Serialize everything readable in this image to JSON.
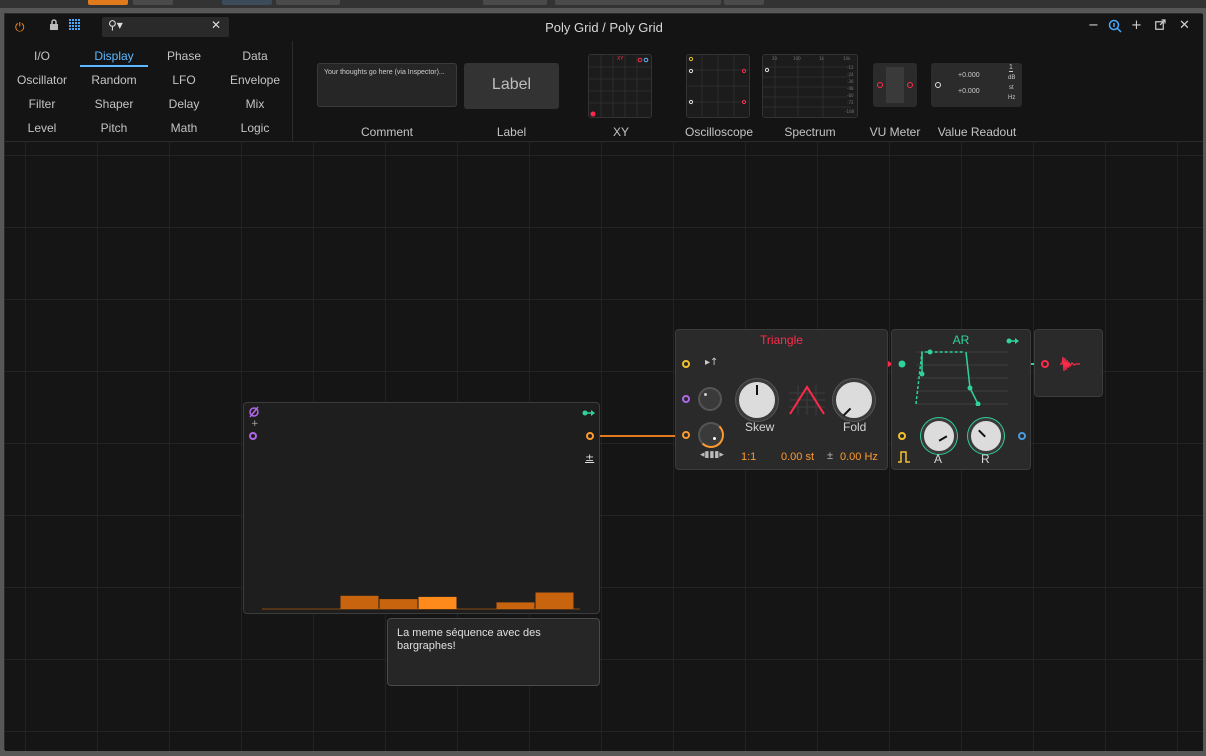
{
  "window": {
    "title": "Poly Grid / Poly Grid"
  },
  "toolbar": {
    "icons": [
      "power-icon",
      "lock-icon",
      "grid-icon",
      "search-icon",
      "close-icon"
    ],
    "search_value": "",
    "window_controls": [
      "minimize-icon",
      "zoom-icon",
      "add-icon",
      "popout-icon",
      "close-icon"
    ]
  },
  "browser": {
    "categories": [
      [
        "I/O",
        "Display",
        "Phase",
        "Data"
      ],
      [
        "Oscillator",
        "Random",
        "LFO",
        "Envelope"
      ],
      [
        "Filter",
        "Shaper",
        "Delay",
        "Mix"
      ],
      [
        "Level",
        "Pitch",
        "Math",
        "Logic"
      ]
    ],
    "selected_category": "Display",
    "devices": {
      "comment": {
        "label": "Comment",
        "preview_text": "Your thoughts go here (via Inspector)..."
      },
      "label": {
        "label": "Label",
        "preview_text": "Label"
      },
      "xy": {
        "label": "XY",
        "preview_text": "XY"
      },
      "oscilloscope": {
        "label": "Oscilloscope"
      },
      "spectrum": {
        "label": "Spectrum",
        "ticks_top": [
          "20",
          "100",
          "1k",
          "10k"
        ],
        "ticks_right": [
          "-12",
          "-24",
          "-36",
          "-48",
          "-60",
          "-72",
          "-108"
        ]
      },
      "vu_meter": {
        "label": "VU Meter"
      },
      "value_readout": {
        "label": "Value Readout",
        "value1": "+0.000",
        "value2": "+0.000",
        "units": [
          "1",
          "dB",
          "st",
          "Hz"
        ]
      }
    }
  },
  "modules": {
    "bargraph": {
      "plus_label": "+",
      "pm_label": "±",
      "bars": [
        0,
        0,
        0.6,
        0.45,
        0.55,
        0,
        0.3,
        0.75
      ],
      "note": "La meme séquence avec des bargraphes!"
    },
    "triangle": {
      "title": "Triangle",
      "knob_skew": "Skew",
      "knob_fold": "Fold",
      "ratio": "1:1",
      "semitones": "0.00 st",
      "pm": "±",
      "hz": "0.00 Hz"
    },
    "ar": {
      "title": "AR",
      "knob_a": "A",
      "knob_r": "R"
    }
  },
  "colors": {
    "accent_blue": "#5cb8ff",
    "orange": "#ff9a2e",
    "red": "#ff2a4a",
    "green": "#2fd39a",
    "yellow": "#f2c230",
    "purple": "#b068e8"
  }
}
